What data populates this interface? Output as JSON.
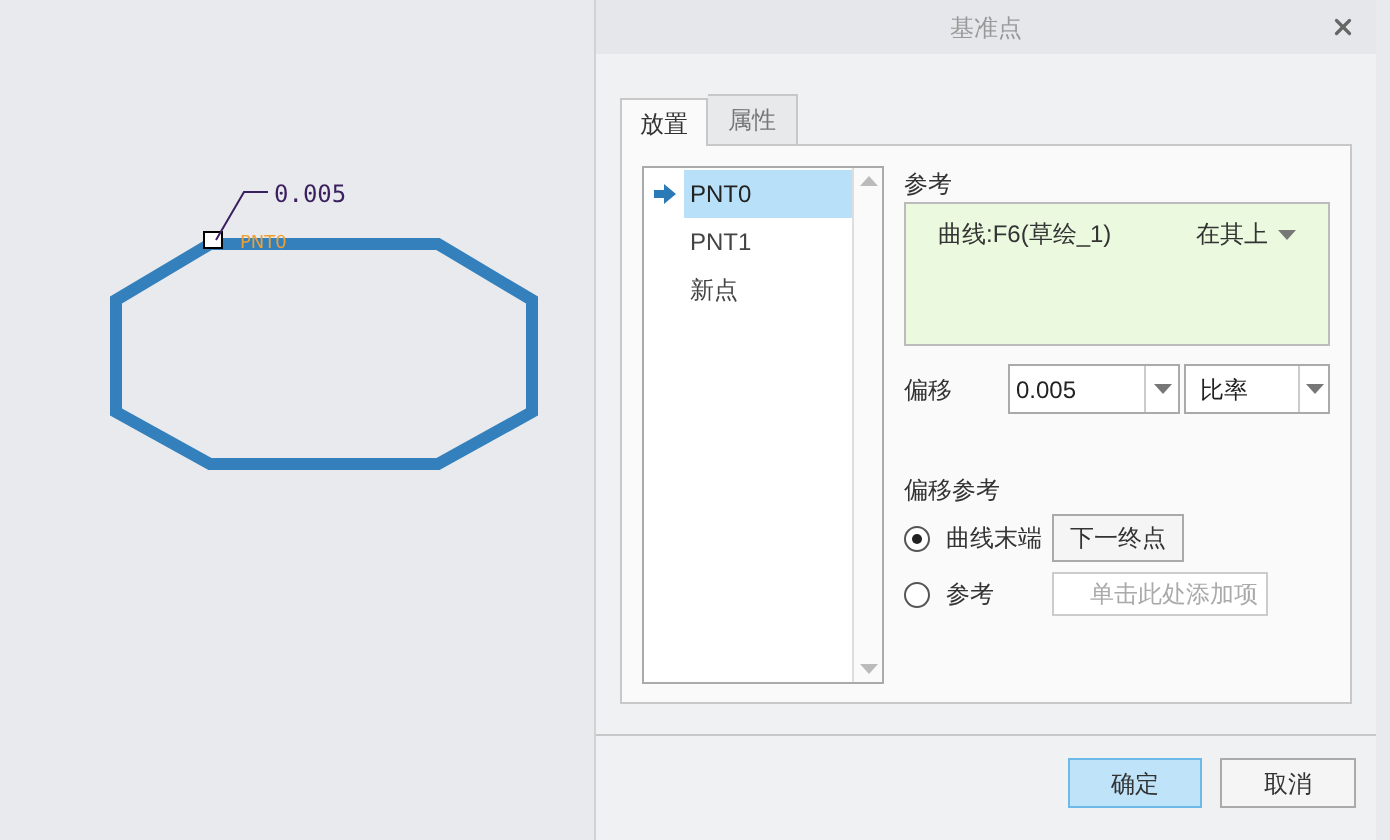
{
  "canvas": {
    "dimension": "0.005",
    "point_label": "PNT0"
  },
  "dialog": {
    "title": "基准点"
  },
  "tabs": [
    {
      "label": "放置",
      "selected": true
    },
    {
      "label": "属性",
      "selected": false
    }
  ],
  "points": [
    {
      "label": "PNT0",
      "selected": true
    },
    {
      "label": "PNT1",
      "selected": false
    },
    {
      "label": "新点",
      "selected": false
    }
  ],
  "reference": {
    "label": "参考",
    "item": "曲线:F6(草绘_1)",
    "constraint": "在其上"
  },
  "offset": {
    "label": "偏移",
    "value": "0.005",
    "type": "比率"
  },
  "offset_reference": {
    "label": "偏移参考",
    "options": [
      {
        "kind": "button",
        "label": "曲线末端",
        "selected": true,
        "button": "下一终点"
      },
      {
        "kind": "field",
        "label": "参考",
        "selected": false,
        "placeholder": "单击此处添加项"
      }
    ]
  },
  "buttons": [
    {
      "label": "确定",
      "kind": "primary"
    },
    {
      "label": "取消",
      "kind": "secondary"
    }
  ]
}
